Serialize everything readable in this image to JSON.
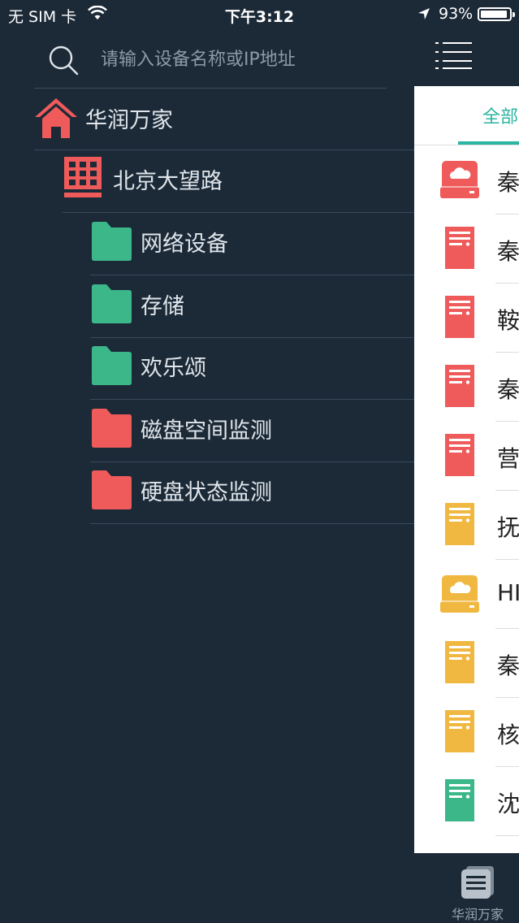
{
  "status_bar": {
    "carrier": "无 SIM 卡",
    "time": "下午3:12",
    "battery_percent": "93%",
    "battery_level": 0.93
  },
  "search": {
    "placeholder": "请输入设备名称或IP地址",
    "icon": "search-icon"
  },
  "tree": {
    "root": {
      "label": "华润万家",
      "icon": "home-icon",
      "color": "#ef5a5a"
    },
    "site": {
      "label": "北京大望路",
      "icon": "building-icon",
      "color": "#ef5a5a"
    },
    "groups": [
      {
        "label": "网络设备",
        "icon": "folder-icon",
        "color": "#3bb78a"
      },
      {
        "label": "存储",
        "icon": "folder-icon",
        "color": "#3bb78a"
      },
      {
        "label": "欢乐颂",
        "icon": "folder-icon",
        "color": "#3bb78a"
      },
      {
        "label": "磁盘空间监测",
        "icon": "folder-icon",
        "color": "#ef5a5a"
      },
      {
        "label": "硬盘状态监测",
        "icon": "folder-icon",
        "color": "#ef5a5a"
      }
    ]
  },
  "right_panel": {
    "menu_icon": "menu-icon",
    "tab_all": "全部",
    "devices": [
      {
        "name": "秦",
        "icon": "cloud-storage-icon",
        "color": "#ef5a5a"
      },
      {
        "name": "秦",
        "icon": "server-icon",
        "color": "#ef5a5a"
      },
      {
        "name": "鞍",
        "icon": "server-icon",
        "color": "#ef5a5a"
      },
      {
        "name": "秦",
        "icon": "server-icon",
        "color": "#ef5a5a"
      },
      {
        "name": "营",
        "icon": "server-icon",
        "color": "#ef5a5a"
      },
      {
        "name": "抚",
        "icon": "server-icon",
        "color": "#f0b840"
      },
      {
        "name": "HI",
        "icon": "cloud-storage-icon",
        "color": "#f0b840"
      },
      {
        "name": "秦",
        "icon": "server-icon",
        "color": "#f0b840"
      },
      {
        "name": "核",
        "icon": "server-icon",
        "color": "#f0b840"
      },
      {
        "name": "沈",
        "icon": "server-icon",
        "color": "#3bb78a"
      }
    ]
  },
  "bottom_tab": {
    "label": "华润万家",
    "icon": "documents-icon"
  }
}
